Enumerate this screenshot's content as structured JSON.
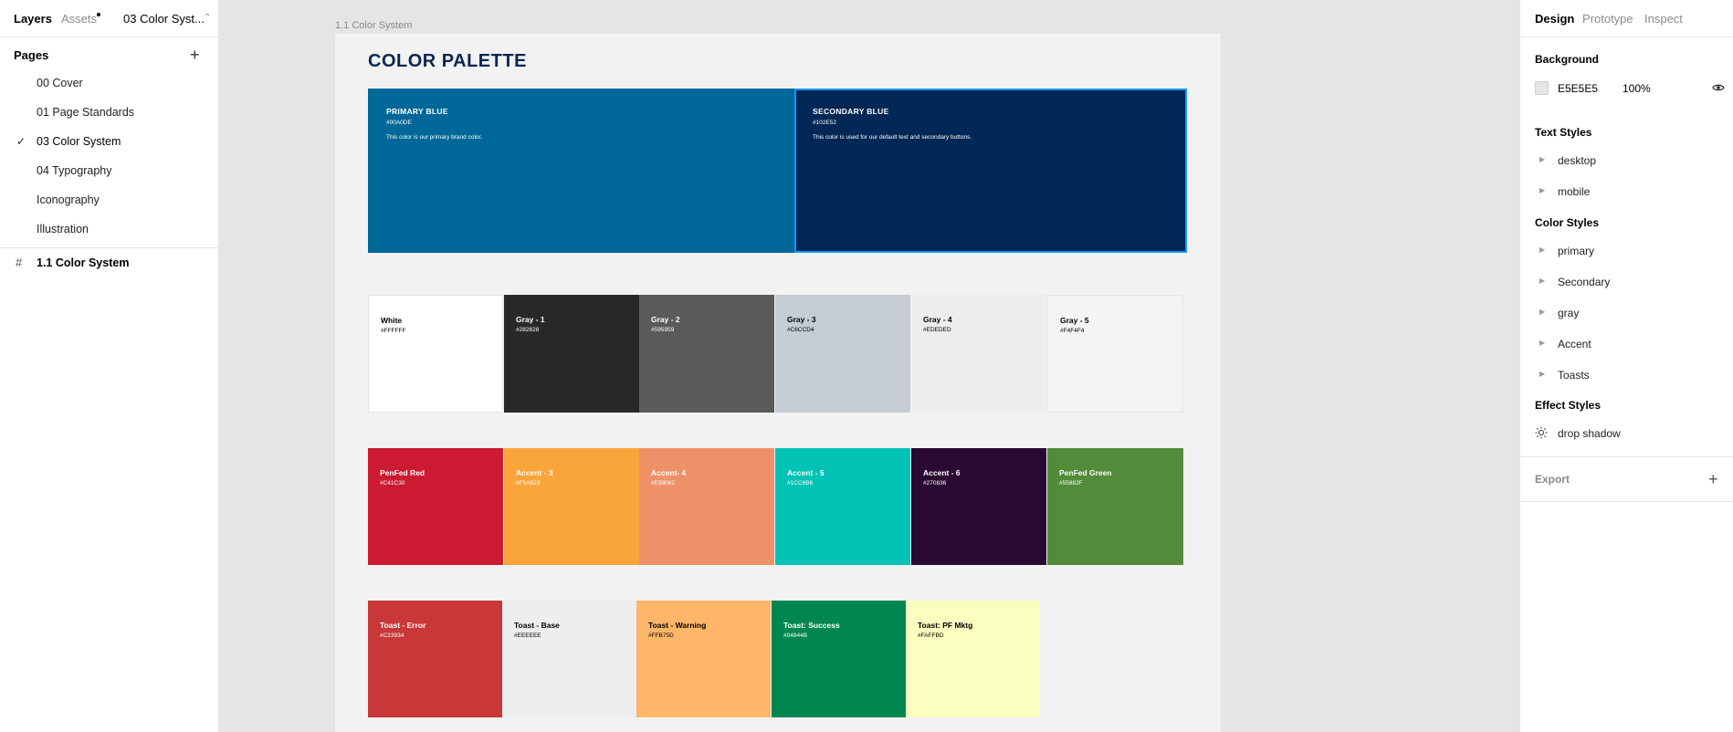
{
  "left_panel": {
    "tabs": {
      "layers": "Layers",
      "assets": "Assets",
      "current_page": "03 Color Syst..."
    },
    "pages_title": "Pages",
    "pages": [
      {
        "label": "00 Cover",
        "selected": false
      },
      {
        "label": "01 Page Standards",
        "selected": false
      },
      {
        "label": "03 Color System",
        "selected": true
      },
      {
        "label": "04 Typography",
        "selected": false
      },
      {
        "label": "Iconography",
        "selected": false
      },
      {
        "label": "Illustration",
        "selected": false
      }
    ],
    "layer": "1.1 Color System"
  },
  "canvas": {
    "frame_label": "1.1 Color System",
    "title": "COLOR PALETTE",
    "primary_swatches": [
      {
        "name": "PRIMARY BLUE",
        "hex": "#00A0DE",
        "description": "This color is our primary brand color.",
        "color": "#006898",
        "text_color": "#ffffff",
        "selected": false
      },
      {
        "name": "SECONDARY BLUE",
        "hex": "#102E52",
        "description": "This color is used for our default text and secondary buttons.",
        "color": "#002755",
        "text_color": "#ffffff",
        "selected": true
      }
    ],
    "gray_swatches": [
      {
        "name": "White",
        "hex": "#FFFFFF",
        "color": "#ffffff",
        "text_color": "#000000"
      },
      {
        "name": "Gray - 1",
        "hex": "#282828",
        "color": "#282828",
        "text_color": "#ffffff"
      },
      {
        "name": "Gray - 2",
        "hex": "#595959",
        "color": "#5a5a5a",
        "text_color": "#ffffff"
      },
      {
        "name": "Gray - 3",
        "hex": "#C6CCD4",
        "color": "#c6ccd4",
        "text_color": "#000000"
      },
      {
        "name": "Gray - 4",
        "hex": "#EDEDED",
        "color": "#ededed",
        "text_color": "#000000"
      },
      {
        "name": "Gray - 5",
        "hex": "#F4F4F4",
        "color": "#f4f4f4",
        "text_color": "#000000"
      }
    ],
    "accent_swatches": [
      {
        "name": "PenFed Red",
        "hex": "#C41C30",
        "color": "#cb1a32",
        "text_color": "#ffffff"
      },
      {
        "name": "Accent - 3",
        "hex": "#F5A623",
        "color": "#f9a53b",
        "text_color": "#ffffff"
      },
      {
        "name": "Accent- 4",
        "hex": "#E99062",
        "color": "#ee9168",
        "text_color": "#ffffff"
      },
      {
        "name": "Accent - 5",
        "hex": "#1CC6B6",
        "color": "#00c3b6",
        "text_color": "#ffffff"
      },
      {
        "name": "Accent - 6",
        "hex": "#270836",
        "color": "#290832",
        "text_color": "#ffffff"
      },
      {
        "name": "PenFed Green",
        "hex": "#55882F",
        "color": "#528b3a",
        "text_color": "#ffffff"
      }
    ],
    "toast_swatches": [
      {
        "name": "Toast - Error",
        "hex": "#C23934",
        "color": "#c93838",
        "text_color": "#ffffff"
      },
      {
        "name": "Toast - Base",
        "hex": "#EEEEEE",
        "color": "#eeeeee",
        "text_color": "#000000"
      },
      {
        "name": "Toast - Warning",
        "hex": "#FFB75D",
        "color": "#ffb669",
        "text_color": "#000000"
      },
      {
        "name": "Toast: Success",
        "hex": "#04844B",
        "color": "#00874f",
        "text_color": "#ffffff"
      },
      {
        "name": "Toast: PF Mktg",
        "hex": "#FAFFBD",
        "color": "#f8ffbf",
        "text_color": "#000000"
      }
    ]
  },
  "right_panel": {
    "tabs": {
      "design": "Design",
      "prototype": "Prototype",
      "inspect": "Inspect"
    },
    "background_title": "Background",
    "background": {
      "hex": "E5E5E5",
      "opacity": "100%",
      "color": "#e5e5e5"
    },
    "text_styles_title": "Text Styles",
    "text_styles": [
      "desktop",
      "mobile"
    ],
    "color_styles_title": "Color Styles",
    "color_styles": [
      "primary",
      "Secondary",
      "gray",
      "Accent",
      "Toasts"
    ],
    "effect_styles_title": "Effect Styles",
    "effect_styles": [
      "drop shadow"
    ],
    "export_label": "Export"
  },
  "colors": {
    "selection": "#0d99ff",
    "title": "#0c2650"
  }
}
